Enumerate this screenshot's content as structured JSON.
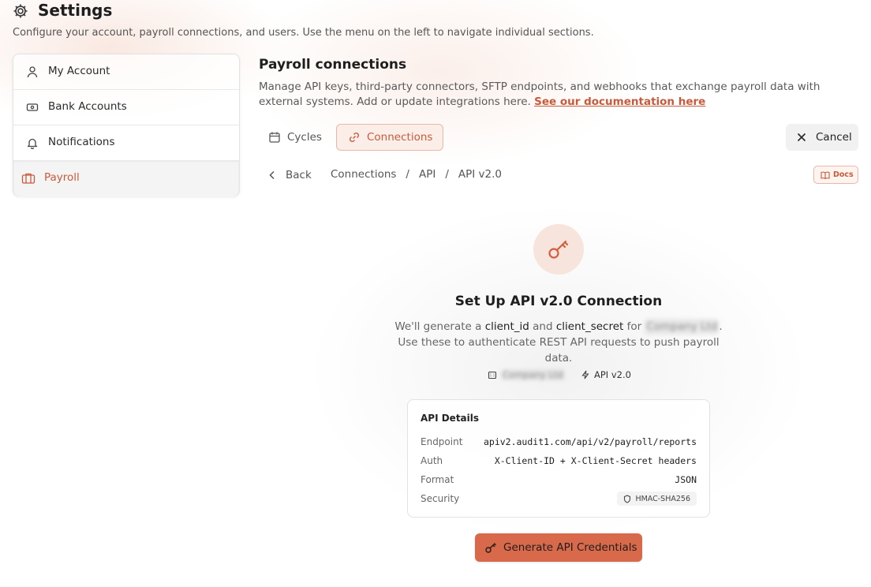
{
  "header": {
    "title": "Settings",
    "subtitle": "Configure your account, payroll connections, and users. Use the menu on the left to navigate individual sections.",
    "icon": "gear-icon"
  },
  "sidebar": {
    "items": [
      {
        "label": "My Account",
        "icon": "user-icon",
        "active": false
      },
      {
        "label": "Bank Accounts",
        "icon": "banknote-icon",
        "active": false
      },
      {
        "label": "Notifications",
        "icon": "bell-icon",
        "active": false
      },
      {
        "label": "Payroll",
        "icon": "briefcase-icon",
        "active": true
      }
    ]
  },
  "section": {
    "title": "Payroll connections",
    "description": "Manage API keys, third-party connectors, SFTP endpoints, and webhooks that exchange payroll data with external systems. Add or update integrations here.",
    "doc_link": "See our documentation here"
  },
  "tabs": [
    {
      "label": "Cycles",
      "icon": "calendar-icon",
      "active": false
    },
    {
      "label": "Connections",
      "icon": "link-icon",
      "active": true
    }
  ],
  "cancel_label": "Cancel",
  "back_label": "Back",
  "breadcrumb": [
    "Connections",
    "/",
    "API",
    "/",
    "API v2.0"
  ],
  "docs_label": "Docs",
  "setup": {
    "title": "Set Up API v2.0 Connection",
    "desc_1": "We'll generate a",
    "client_id": "client_id",
    "desc_and": "and",
    "client_secret": "client_secret",
    "desc_for": "for",
    "redacted_company": "Company Ltd",
    "desc_2": ". Use these to authenticate REST API requests to push payroll data.",
    "chip_company": "Company Ltd",
    "chip_version": "API v2.0"
  },
  "details": {
    "title": "API Details",
    "rows": [
      {
        "key": "Endpoint",
        "value": "apiv2.audit1.com/api/v2/payroll/reports"
      },
      {
        "key": "Auth",
        "value": "X-Client-ID + X-Client-Secret headers"
      },
      {
        "key": "Format",
        "value": "JSON"
      },
      {
        "key": "Security",
        "value": "HMAC-SHA256"
      }
    ]
  },
  "generate_label": "Generate API Credentials",
  "colors": {
    "accent": "#d8694a",
    "accent_text": "#c85a3c",
    "accent_soft": "#fbeee8"
  }
}
